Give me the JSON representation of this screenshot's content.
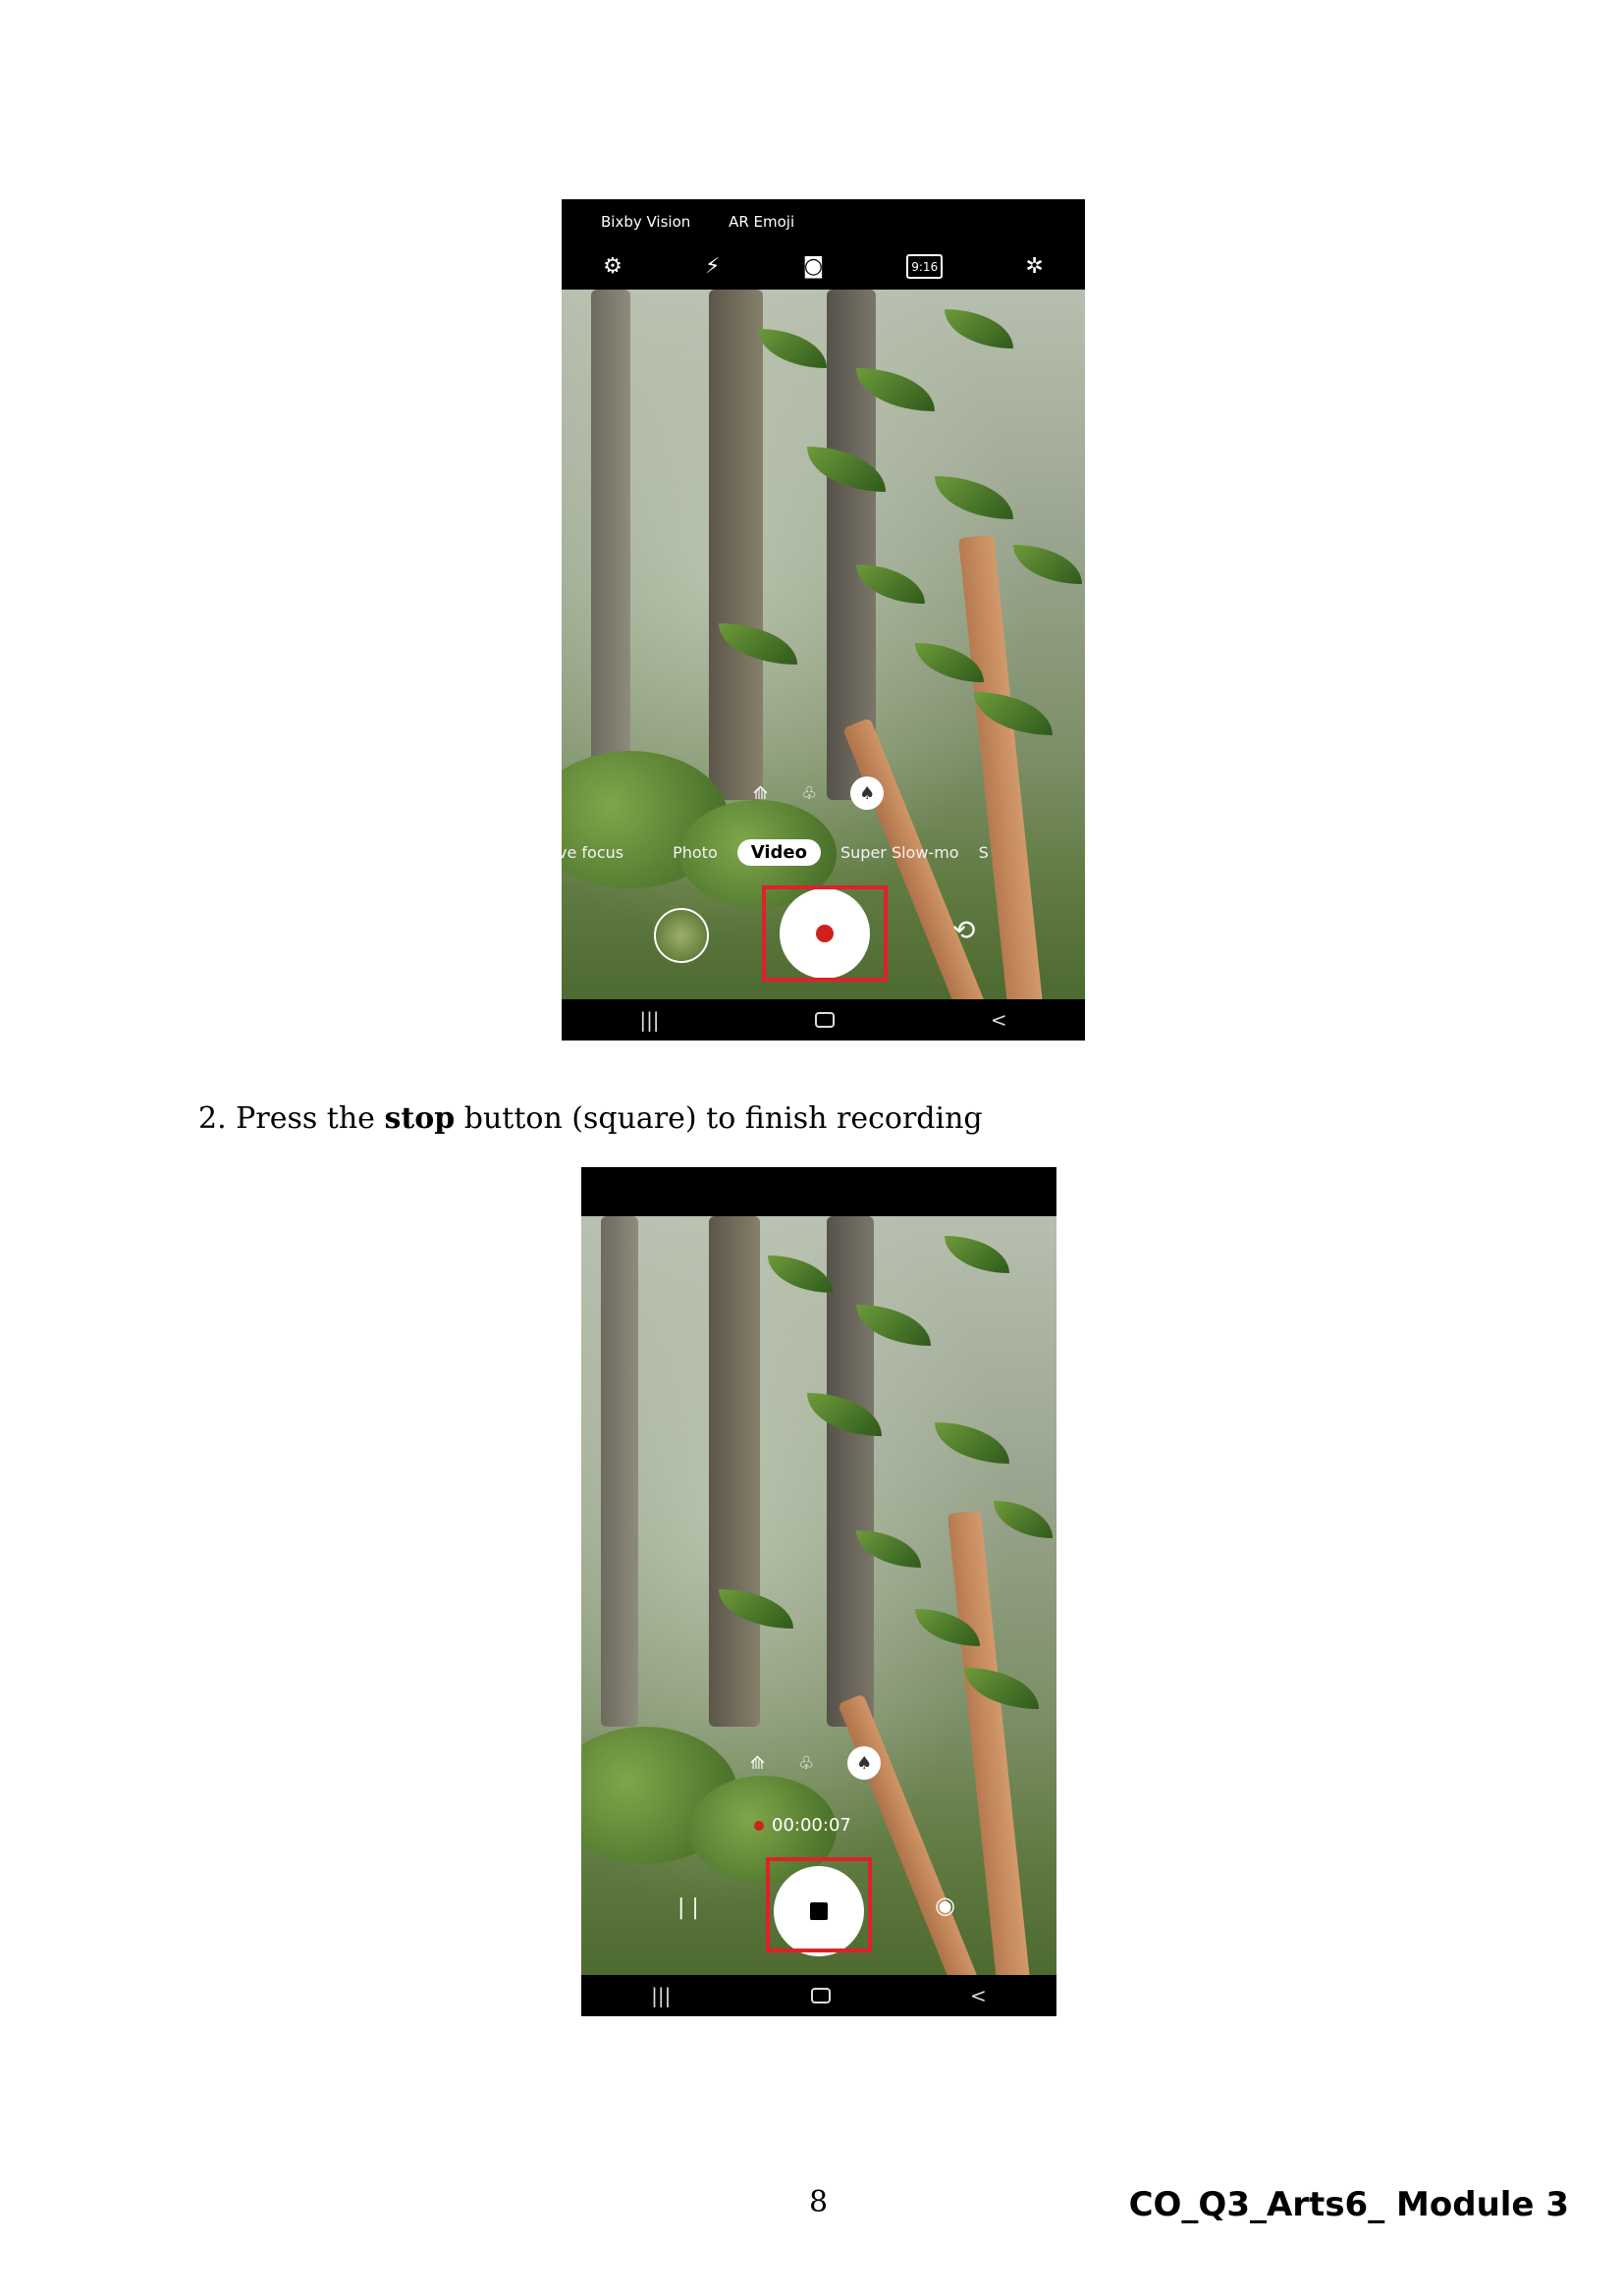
{
  "phone1": {
    "top_links": [
      "Bixby Vision",
      "AR Emoji"
    ],
    "top_icons": [
      "settings-icon",
      "flash-off-icon",
      "motion-icon",
      "aspect-ratio-icon",
      "effects-icon"
    ],
    "aspect_ratio_label": "9:16",
    "lens_icons": [
      "ultra-wide-lens-icon",
      "wide-lens-icon",
      "zoom-lens-icon"
    ],
    "modes": [
      "ve focus",
      "Photo",
      "Video",
      "Super Slow-mo",
      "S"
    ],
    "active_mode": "Video",
    "shutter": "record-button",
    "nav": [
      "|||",
      "<"
    ]
  },
  "instruction": {
    "number": "2.",
    "pre": "Press the",
    "bold": "stop",
    "post": "button (square) to finish recording"
  },
  "phone2": {
    "lens_icons": [
      "ultra-wide-lens-icon",
      "wide-lens-icon",
      "zoom-lens-icon"
    ],
    "timer": "00:00:07",
    "pause_label": "| |",
    "shutter": "stop-button",
    "nav": [
      "|||",
      "<"
    ]
  },
  "footer": {
    "page_number": "8",
    "module": "CO_Q3_Arts6_ Module 3"
  },
  "colors": {
    "highlight": "#e0202a",
    "record": "#d0201e"
  }
}
